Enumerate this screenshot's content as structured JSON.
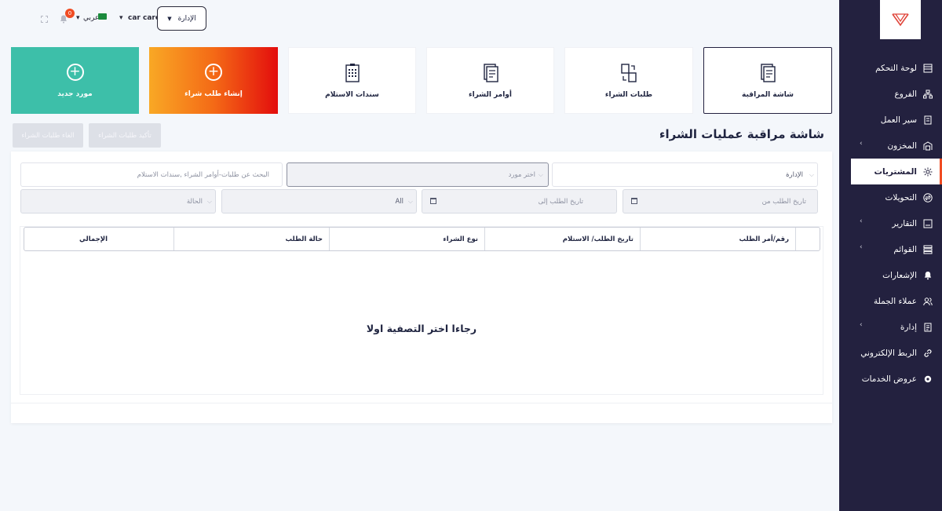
{
  "sidebar": {
    "items": [
      {
        "label": "لوحة التحكم",
        "icon": "chart-icon",
        "chevron": false,
        "active": false
      },
      {
        "label": "الفروع",
        "icon": "branches-icon",
        "chevron": false,
        "active": false
      },
      {
        "label": "سير العمل",
        "icon": "workflow-icon",
        "chevron": false,
        "active": false
      },
      {
        "label": "المخزون",
        "icon": "warehouse-icon",
        "chevron": true,
        "active": false
      },
      {
        "label": "المشتريات",
        "icon": "purchases-icon",
        "chevron": false,
        "active": true
      },
      {
        "label": "التحويلات",
        "icon": "transfers-icon",
        "chevron": false,
        "active": false
      },
      {
        "label": "التقارير",
        "icon": "reports-icon",
        "chevron": true,
        "active": false
      },
      {
        "label": "القوائم",
        "icon": "lists-icon",
        "chevron": true,
        "active": false
      },
      {
        "label": "الإشعارات",
        "icon": "bell-icon",
        "chevron": false,
        "active": false
      },
      {
        "label": "عملاء الجملة",
        "icon": "users-icon",
        "chevron": false,
        "active": false
      },
      {
        "label": "إدارة",
        "icon": "management-icon",
        "chevron": true,
        "active": false
      },
      {
        "label": "الربط الإلكتروني",
        "icon": "link-icon",
        "chevron": false,
        "active": false
      },
      {
        "label": "عروض الخدمات",
        "icon": "gear-icon",
        "chevron": false,
        "active": false
      }
    ]
  },
  "topbar": {
    "admin_label": "الإدارة",
    "company": "car care",
    "language": "عربي",
    "notifications_count": "0"
  },
  "cards": {
    "monitor": "شاشة المراقبة",
    "purchase_requests": "طلبات الشراء",
    "purchase_orders": "أوامر الشراء",
    "receipts": "سندات الاستلام",
    "create_request": "إنشاء طلب شراء",
    "new_supplier": "مورد جديد"
  },
  "page": {
    "title": "شاشة مراقبة عمليات الشراء",
    "confirm_button": "تأكيد طلبات الشراء",
    "cancel_button": "الغاء طلبات الشراء"
  },
  "filters": {
    "admin_select": "الإدارة",
    "supplier_placeholder": "اختر مورد",
    "search_placeholder": "البحث عن طلبات-أوامر الشراء ,سندات الاستلام",
    "date_from_placeholder": "تاريخ الطلب من",
    "date_to_placeholder": "تاريخ الطلب إلى",
    "type_value": "All",
    "status_placeholder": "الحالة"
  },
  "table": {
    "columns": [
      "رقم/أمر الطلب",
      "تاريخ الطلب/ الاستلام",
      "نوع الشراء",
      "حالة الطلب",
      "الإجمالي"
    ],
    "empty_message": "رجاءا اختر التصفية اولا"
  },
  "colors": {
    "sidebar_bg": "#23213f",
    "accent_orange": "#f04c23",
    "green_card": "#3dbfa9"
  }
}
